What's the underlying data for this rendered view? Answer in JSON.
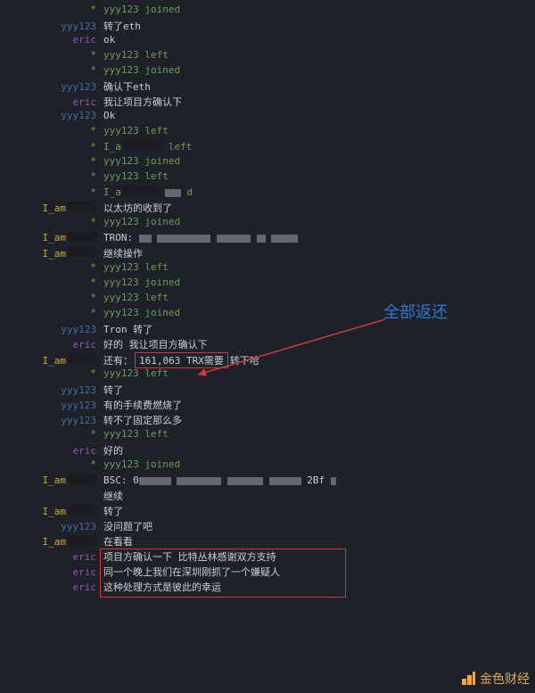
{
  "nicknames": {
    "star": "*",
    "system": "---",
    "yyy": "yyy123",
    "eric": "eric",
    "iam": "I_am"
  },
  "lines": [
    {
      "nick": "star",
      "nickClass": "star",
      "msgClass": "join-leave",
      "text": "yyy123 joined"
    },
    {
      "nick": "yyy",
      "nickClass": "blue",
      "msgClass": "plain",
      "text": "转了eth"
    },
    {
      "nick": "eric",
      "nickClass": "purple",
      "msgClass": "plain",
      "text": "ok"
    },
    {
      "nick": "star",
      "nickClass": "star",
      "msgClass": "join-leave",
      "text": "yyy123 left"
    },
    {
      "nick": "star",
      "nickClass": "star",
      "msgClass": "join-leave",
      "text": "yyy123 joined"
    },
    {
      "nick": "yyy",
      "nickClass": "blue",
      "msgClass": "plain",
      "text": "确认下eth"
    },
    {
      "nick": "eric",
      "nickClass": "purple",
      "msgClass": "plain",
      "text": "我让项目方确认下"
    },
    {
      "nick": "yyy",
      "nickClass": "blue",
      "msgClass": "plain",
      "text": "Ok"
    },
    {
      "nick": "star",
      "nickClass": "star",
      "msgClass": "join-leave",
      "text": "yyy123 left"
    },
    {
      "nick": "star",
      "nickClass": "star",
      "msgClass": "join-leave",
      "special": "iam-left"
    },
    {
      "nick": "star",
      "nickClass": "star",
      "msgClass": "join-leave",
      "text": "yyy123 joined"
    },
    {
      "nick": "star",
      "nickClass": "star",
      "msgClass": "join-leave",
      "text": "yyy123 left"
    },
    {
      "nick": "star",
      "nickClass": "star",
      "msgClass": "join-leave",
      "special": "iam-joined"
    },
    {
      "nick": "iam",
      "nickClass": "yellow",
      "msgClass": "plain",
      "text": "以太坊的收到了"
    },
    {
      "nick": "star",
      "nickClass": "star",
      "msgClass": "join-leave",
      "text": "yyy123 joined"
    },
    {
      "nick": "iam",
      "nickClass": "yellow",
      "msgClass": "plain",
      "special": "tron-blur"
    },
    {
      "nick": "iam",
      "nickClass": "yellow",
      "msgClass": "plain",
      "text": "继续操作"
    },
    {
      "nick": "star",
      "nickClass": "star",
      "msgClass": "join-leave",
      "text": "yyy123 left"
    },
    {
      "nick": "star",
      "nickClass": "star",
      "msgClass": "join-leave",
      "text": "yyy123 joined"
    },
    {
      "nick": "star",
      "nickClass": "star",
      "msgClass": "join-leave",
      "text": "yyy123 left"
    },
    {
      "nick": "star",
      "nickClass": "star",
      "msgClass": "join-leave",
      "text": "yyy123 joined"
    },
    {
      "nick": "yyy",
      "nickClass": "blue",
      "msgClass": "plain",
      "text": "Tron 转了"
    },
    {
      "nick": "eric",
      "nickClass": "purple",
      "msgClass": "plain",
      "text": "好的 我让项目方确认下"
    },
    {
      "nick": "iam",
      "nickClass": "yellow",
      "msgClass": "plain",
      "special": "trx-amount"
    },
    {
      "nick": "star",
      "nickClass": "star",
      "msgClass": "join-leave",
      "text": "yyy123 left"
    },
    {
      "nick": "yyy",
      "nickClass": "blue",
      "msgClass": "plain",
      "text": "转了"
    },
    {
      "nick": "yyy",
      "nickClass": "blue",
      "msgClass": "plain",
      "text": "有的手续费燃烧了"
    },
    {
      "nick": "yyy",
      "nickClass": "blue",
      "msgClass": "plain",
      "text": "转不了固定那么多"
    },
    {
      "nick": "star",
      "nickClass": "star",
      "msgClass": "join-leave",
      "text": "yyy123 left"
    },
    {
      "nick": "eric",
      "nickClass": "purple",
      "msgClass": "plain",
      "text": "好的"
    },
    {
      "nick": "star",
      "nickClass": "star",
      "msgClass": "join-leave",
      "text": "yyy123 joined"
    },
    {
      "nick": "iam",
      "nickClass": "yellow",
      "msgClass": "plain",
      "special": "bsc-blur"
    },
    {
      "nick": "iam",
      "nickClass": "yellow",
      "msgClass": "plain",
      "text": "继续",
      "hideNick": true
    },
    {
      "nick": "iam",
      "nickClass": "yellow",
      "msgClass": "plain",
      "text": "转了"
    },
    {
      "nick": "yyy",
      "nickClass": "blue",
      "msgClass": "plain",
      "text": "没问题了吧"
    },
    {
      "nick": "iam",
      "nickClass": "yellow",
      "msgClass": "plain",
      "text": "在看看"
    },
    {
      "nick": "eric",
      "nickClass": "purple",
      "msgClass": "plain",
      "text": "项目方确认一下 比特丛林感谢双方支持"
    },
    {
      "nick": "eric",
      "nickClass": "purple",
      "msgClass": "plain",
      "text": "同一个晚上我们在深圳刚抓了一个嫌疑人"
    },
    {
      "nick": "eric",
      "nickClass": "purple",
      "msgClass": "plain",
      "text": "这种处理方式是彼此的幸运"
    }
  ],
  "trx": {
    "prefix": "还有：",
    "amount": "161,063 TRX",
    "middle": "需要",
    "suffix": "转下哈"
  },
  "iamLeft": {
    "prefix": "I_a",
    "suffix": "left"
  },
  "iamJoined": {
    "prefix": "I_a",
    "suffix": "d"
  },
  "tronLabel": "TRON: ",
  "bscLabel": "BSC: 0",
  "bscTail": "  2Bf",
  "annotation": "全部返还",
  "watermark": "金色财经"
}
